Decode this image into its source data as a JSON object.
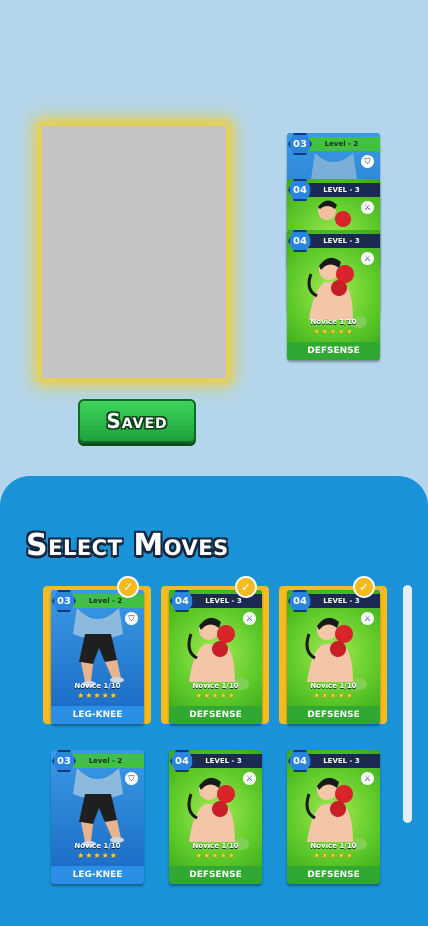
{
  "deck": {
    "cards": [
      {
        "level_num": "03",
        "level_label": "Level - 2",
        "name": "",
        "rank": "",
        "style": "blue",
        "type_icon": "shield-icon"
      },
      {
        "level_num": "04",
        "level_label": "LEVEL - 3",
        "name": "",
        "rank": "",
        "style": "green",
        "type_icon": "sword-icon"
      },
      {
        "level_num": "04",
        "level_label": "LEVEL - 3",
        "name": "DEFSENSE",
        "rank": "Novice 1/10",
        "style": "green",
        "type_icon": "sword-icon"
      }
    ]
  },
  "saved_button": {
    "label": "Saved"
  },
  "panel": {
    "title": "Select Moves",
    "cards": [
      {
        "level_num": "03",
        "level_label": "Level - 2",
        "name": "LEG-KNEE",
        "rank": "Novice 1/10",
        "stars": "★★★★★",
        "style": "blue",
        "selected": true
      },
      {
        "level_num": "04",
        "level_label": "LEVEL - 3",
        "name": "DEFSENSE",
        "rank": "Novice 1/10",
        "stars": "★★★★★",
        "style": "green",
        "selected": true
      },
      {
        "level_num": "04",
        "level_label": "LEVEL - 3",
        "name": "DEFSENSE",
        "rank": "Novice 1/10",
        "stars": "★★★★★",
        "style": "green",
        "selected": true
      },
      {
        "level_num": "03",
        "level_label": "Level - 2",
        "name": "LEG-KNEE",
        "rank": "Novice 1/10",
        "stars": "★★★★★",
        "style": "blue",
        "selected": false
      },
      {
        "level_num": "04",
        "level_label": "LEVEL - 3",
        "name": "DEFSENSE",
        "rank": "Novice 1/10",
        "stars": "★★★★★",
        "style": "green",
        "selected": false
      },
      {
        "level_num": "04",
        "level_label": "LEVEL - 3",
        "name": "DEFSENSE",
        "rank": "Novice 1/10",
        "stars": "★★★★★",
        "style": "green",
        "selected": false
      }
    ]
  },
  "check_glyph": "✓"
}
